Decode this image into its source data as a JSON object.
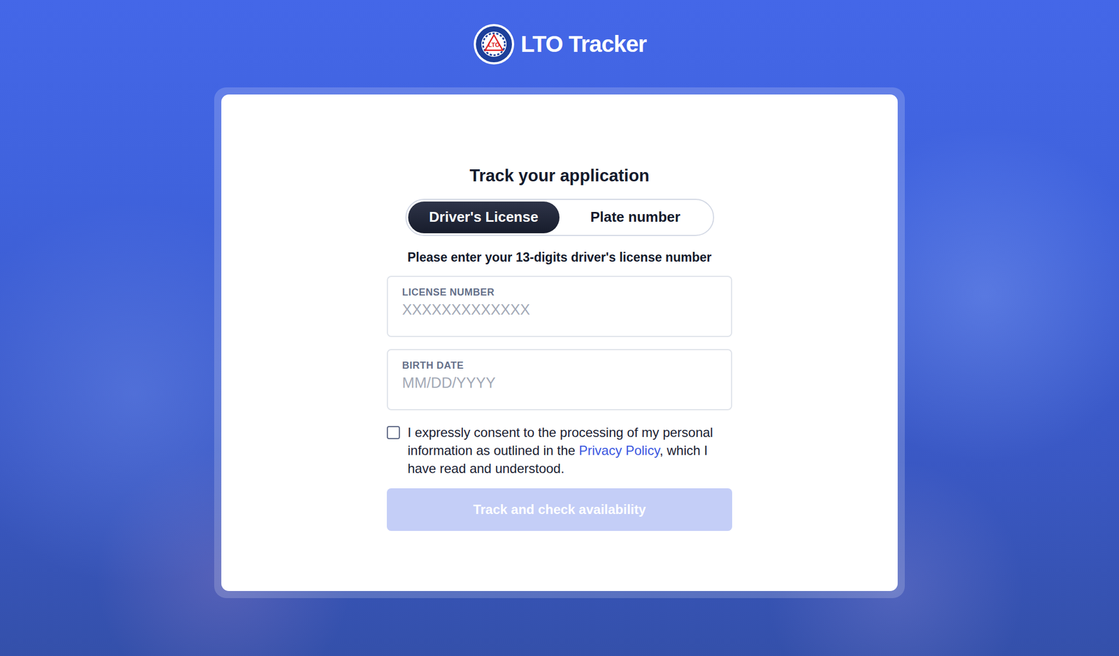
{
  "logo": {
    "emblem": "LTO",
    "text": "LTO Tracker"
  },
  "title": "Track your application",
  "tabs": [
    {
      "label": "Driver's License",
      "selected": true
    },
    {
      "label": "Plate number",
      "selected": false
    }
  ],
  "instruction": "Please enter your 13-digits driver's license number",
  "fields": [
    {
      "label": "LICENSE NUMBER",
      "placeholder": "XXXXXXXXXXXXX"
    },
    {
      "label": "BIRTH DATE",
      "placeholder": "MM/DD/YYYY"
    }
  ],
  "consent": {
    "checked": false,
    "before": "I expressly consent to the processing of my personal information as outlined in the ",
    "link": "Privacy Policy",
    "after": ", which I have read and understood."
  },
  "button": {
    "label": "Track and check availability",
    "disabled": true
  }
}
